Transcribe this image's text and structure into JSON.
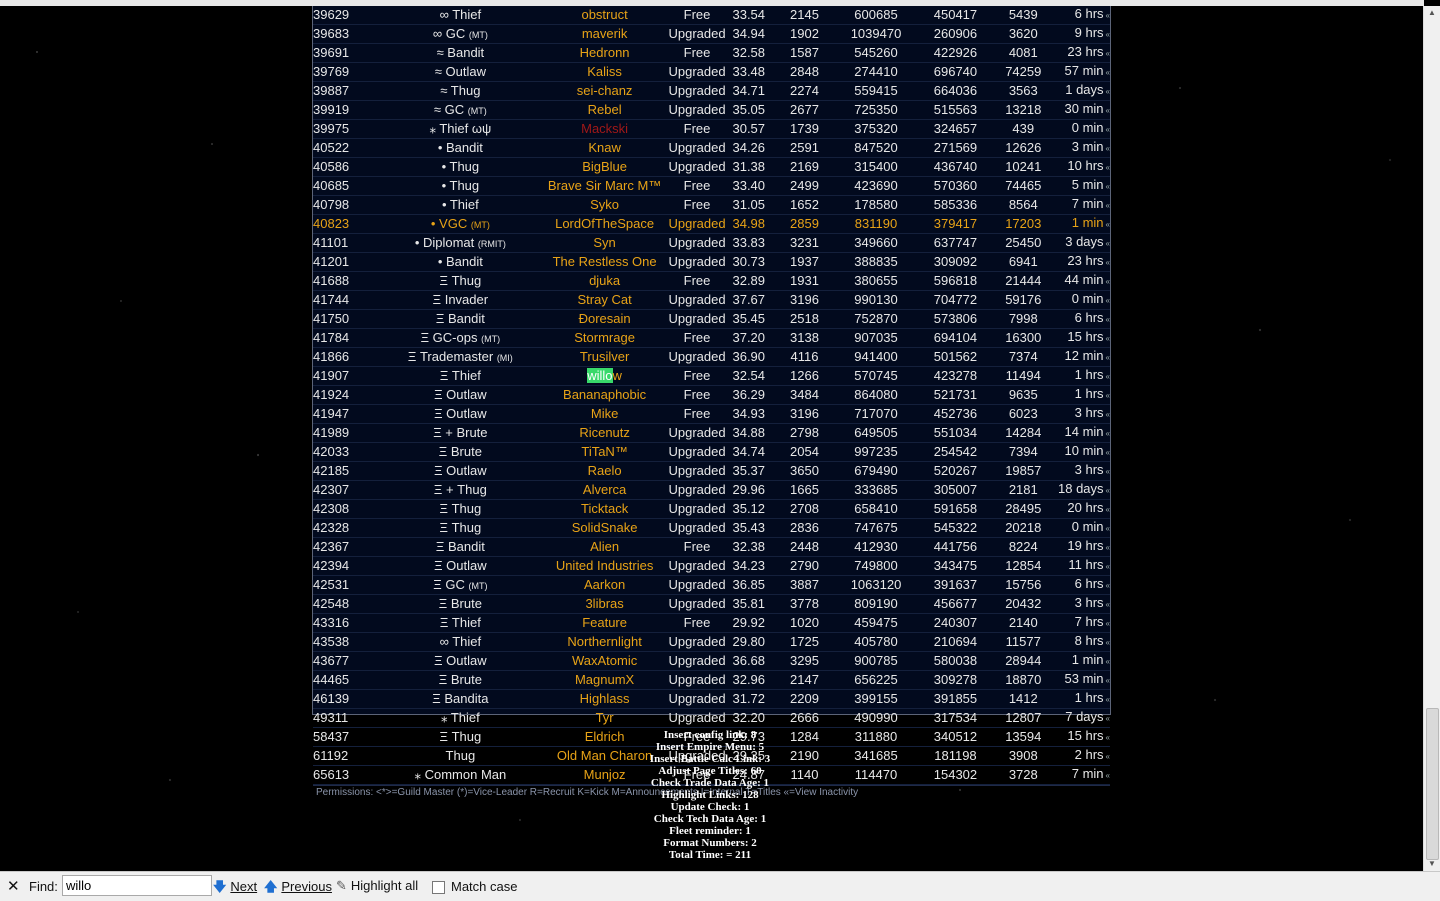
{
  "members": [
    {
      "id": "39629",
      "rank": "∞ Thief",
      "tag": "",
      "name": "obstruct",
      "acct": "Free",
      "lvl": "33.54",
      "a": "2145",
      "b": "600685",
      "c": "450417",
      "d": "5439",
      "active": "6 hrs"
    },
    {
      "id": "39683",
      "rank": "∞ GC",
      "tag": "(MT)",
      "name": "maverik",
      "acct": "Upgraded",
      "lvl": "34.94",
      "a": "1902",
      "b": "1039470",
      "c": "260906",
      "d": "3620",
      "active": "9 hrs"
    },
    {
      "id": "39691",
      "rank": "≈ Bandit",
      "tag": "",
      "name": "Hedronn",
      "acct": "Free",
      "lvl": "32.58",
      "a": "1587",
      "b": "545260",
      "c": "422926",
      "d": "4081",
      "active": "23 hrs"
    },
    {
      "id": "39769",
      "rank": "≈ Outlaw",
      "tag": "",
      "name": "Kaliss",
      "acct": "Upgraded",
      "lvl": "33.48",
      "a": "2848",
      "b": "274410",
      "c": "696740",
      "d": "74259",
      "active": "57 min"
    },
    {
      "id": "39887",
      "rank": "≈ Thug",
      "tag": "",
      "name": "sei-chanz",
      "acct": "Upgraded",
      "lvl": "34.71",
      "a": "2274",
      "b": "559415",
      "c": "664036",
      "d": "3563",
      "active": "1 days"
    },
    {
      "id": "39919",
      "rank": "≈ GC",
      "tag": "(MT)",
      "name": "Rebel",
      "acct": "Upgraded",
      "lvl": "35.05",
      "a": "2677",
      "b": "725350",
      "c": "515563",
      "d": "13218",
      "active": "30 min"
    },
    {
      "id": "39975",
      "rank": "⁎ Thief ωψ",
      "tag": "",
      "name": "Mackski",
      "acct": "Free",
      "lvl": "30.57",
      "a": "1739",
      "b": "375320",
      "c": "324657",
      "d": "439",
      "active": "0 min"
    },
    {
      "id": "40522",
      "rank": "• Bandit",
      "tag": "",
      "name": "Knaw",
      "acct": "Upgraded",
      "lvl": "34.26",
      "a": "2591",
      "b": "847520",
      "c": "271569",
      "d": "12626",
      "active": "3 min"
    },
    {
      "id": "40586",
      "rank": "• Thug",
      "tag": "",
      "name": "BigBlue",
      "acct": "Upgraded",
      "lvl": "31.38",
      "a": "2169",
      "b": "315400",
      "c": "436740",
      "d": "10241",
      "active": "10 hrs"
    },
    {
      "id": "40685",
      "rank": "• Thug",
      "tag": "",
      "name": "Brave Sir Marc M™",
      "acct": "Free",
      "lvl": "33.40",
      "a": "2499",
      "b": "423690",
      "c": "570360",
      "d": "74465",
      "active": "5 min"
    },
    {
      "id": "40798",
      "rank": "• Thief",
      "tag": "",
      "name": "Syko",
      "acct": "Free",
      "lvl": "31.05",
      "a": "1652",
      "b": "178580",
      "c": "585336",
      "d": "8564",
      "active": "7 min"
    },
    {
      "id": "40823",
      "rank": "• VGC",
      "tag": "(MT)",
      "name": "LordOfTheSpace",
      "acct": "Upgraded",
      "lvl": "34.98",
      "a": "2859",
      "b": "831190",
      "c": "379417",
      "d": "17203",
      "active": "1 min"
    },
    {
      "id": "41101",
      "rank": "• Diplomat",
      "tag": "(RMIT)",
      "name": "Syn",
      "acct": "Upgraded",
      "lvl": "33.83",
      "a": "3231",
      "b": "349660",
      "c": "637747",
      "d": "25450",
      "active": "3 days"
    },
    {
      "id": "41201",
      "rank": "• Bandit",
      "tag": "",
      "name": "The Restless One",
      "acct": "Upgraded",
      "lvl": "30.73",
      "a": "1937",
      "b": "388835",
      "c": "309092",
      "d": "6941",
      "active": "23 hrs"
    },
    {
      "id": "41688",
      "rank": "Ξ Thug",
      "tag": "",
      "name": "djuka",
      "acct": "Free",
      "lvl": "32.89",
      "a": "1931",
      "b": "380655",
      "c": "596818",
      "d": "21444",
      "active": "44 min"
    },
    {
      "id": "41744",
      "rank": "Ξ Invader",
      "tag": "",
      "name": "Stray Cat",
      "acct": "Upgraded",
      "lvl": "37.67",
      "a": "3196",
      "b": "990130",
      "c": "704772",
      "d": "59176",
      "active": "0 min"
    },
    {
      "id": "41750",
      "rank": "Ξ Bandit",
      "tag": "",
      "name": "Ðoresain",
      "acct": "Upgraded",
      "lvl": "35.45",
      "a": "2518",
      "b": "752870",
      "c": "573806",
      "d": "7998",
      "active": "6 hrs"
    },
    {
      "id": "41784",
      "rank": "Ξ GC-ops",
      "tag": "(MT)",
      "name": "Stormrage",
      "acct": "Free",
      "lvl": "37.20",
      "a": "3138",
      "b": "907035",
      "c": "694104",
      "d": "16300",
      "active": "15 hrs"
    },
    {
      "id": "41866",
      "rank": "Ξ Trademaster",
      "tag": "(MI)",
      "name": "Trusilver",
      "acct": "Upgraded",
      "lvl": "36.90",
      "a": "4116",
      "b": "941400",
      "c": "501562",
      "d": "7374",
      "active": "12 min"
    },
    {
      "id": "41907",
      "rank": "Ξ Thief",
      "tag": "",
      "name": "willow",
      "acct": "Free",
      "lvl": "32.54",
      "a": "1266",
      "b": "570745",
      "c": "423278",
      "d": "11494",
      "active": "1 hrs"
    },
    {
      "id": "41924",
      "rank": "Ξ Outlaw",
      "tag": "",
      "name": "Bananaphobic",
      "acct": "Free",
      "lvl": "36.29",
      "a": "3484",
      "b": "864080",
      "c": "521731",
      "d": "9635",
      "active": "1 hrs"
    },
    {
      "id": "41947",
      "rank": "Ξ Outlaw",
      "tag": "",
      "name": "Mike",
      "acct": "Free",
      "lvl": "34.93",
      "a": "3196",
      "b": "717070",
      "c": "452736",
      "d": "6023",
      "active": "3 hrs"
    },
    {
      "id": "41989",
      "rank": "Ξ + Brute",
      "tag": "",
      "name": "Ricenutz",
      "acct": "Upgraded",
      "lvl": "34.88",
      "a": "2798",
      "b": "649505",
      "c": "551034",
      "d": "14284",
      "active": "14 min"
    },
    {
      "id": "42033",
      "rank": "Ξ Brute",
      "tag": "",
      "name": "TiTaN™",
      "acct": "Upgraded",
      "lvl": "34.74",
      "a": "2054",
      "b": "997235",
      "c": "254542",
      "d": "7394",
      "active": "10 min"
    },
    {
      "id": "42185",
      "rank": "Ξ Outlaw",
      "tag": "",
      "name": "Raelo",
      "acct": "Upgraded",
      "lvl": "35.37",
      "a": "3650",
      "b": "679490",
      "c": "520267",
      "d": "19857",
      "active": "3 hrs"
    },
    {
      "id": "42307",
      "rank": "Ξ + Thug",
      "tag": "",
      "name": "Alverca",
      "acct": "Upgraded",
      "lvl": "29.96",
      "a": "1665",
      "b": "333685",
      "c": "305007",
      "d": "2181",
      "active": "18 days"
    },
    {
      "id": "42308",
      "rank": "Ξ Thug",
      "tag": "",
      "name": "Ticktack",
      "acct": "Upgraded",
      "lvl": "35.12",
      "a": "2708",
      "b": "658410",
      "c": "591658",
      "d": "28495",
      "active": "20 hrs"
    },
    {
      "id": "42328",
      "rank": "Ξ Thug",
      "tag": "",
      "name": "SolidSnake",
      "acct": "Upgraded",
      "lvl": "35.43",
      "a": "2836",
      "b": "747675",
      "c": "545322",
      "d": "20218",
      "active": "0 min"
    },
    {
      "id": "42367",
      "rank": "Ξ Bandit",
      "tag": "",
      "name": "Alien",
      "acct": "Free",
      "lvl": "32.38",
      "a": "2448",
      "b": "412930",
      "c": "441756",
      "d": "8224",
      "active": "19 hrs"
    },
    {
      "id": "42394",
      "rank": "Ξ Outlaw",
      "tag": "",
      "name": "United Industries",
      "acct": "Upgraded",
      "lvl": "34.23",
      "a": "2790",
      "b": "749800",
      "c": "343475",
      "d": "12854",
      "active": "11 hrs"
    },
    {
      "id": "42531",
      "rank": "Ξ GC",
      "tag": "(MT)",
      "name": "Aarkon",
      "acct": "Upgraded",
      "lvl": "36.85",
      "a": "3887",
      "b": "1063120",
      "c": "391637",
      "d": "15756",
      "active": "6 hrs"
    },
    {
      "id": "42548",
      "rank": "Ξ Brute",
      "tag": "",
      "name": "3libras",
      "acct": "Upgraded",
      "lvl": "35.81",
      "a": "3778",
      "b": "809190",
      "c": "456677",
      "d": "20432",
      "active": "3 hrs"
    },
    {
      "id": "43316",
      "rank": "Ξ Thief",
      "tag": "",
      "name": "Feature",
      "acct": "Free",
      "lvl": "29.92",
      "a": "1020",
      "b": "459475",
      "c": "240307",
      "d": "2140",
      "active": "7 hrs"
    },
    {
      "id": "43538",
      "rank": "∞ Thief",
      "tag": "",
      "name": "Northernlight",
      "acct": "Upgraded",
      "lvl": "29.80",
      "a": "1725",
      "b": "405780",
      "c": "210694",
      "d": "11577",
      "active": "8 hrs"
    },
    {
      "id": "43677",
      "rank": "Ξ Outlaw",
      "tag": "",
      "name": "WaxAtomic",
      "acct": "Upgraded",
      "lvl": "36.68",
      "a": "3295",
      "b": "900785",
      "c": "580038",
      "d": "28944",
      "active": "1 min"
    },
    {
      "id": "44465",
      "rank": "Ξ Brute",
      "tag": "",
      "name": "MagnumX",
      "acct": "Upgraded",
      "lvl": "32.96",
      "a": "2147",
      "b": "656225",
      "c": "309278",
      "d": "18870",
      "active": "53 min"
    },
    {
      "id": "46139",
      "rank": "Ξ Bandita",
      "tag": "",
      "name": "Highlass",
      "acct": "Upgraded",
      "lvl": "31.72",
      "a": "2209",
      "b": "399155",
      "c": "391855",
      "d": "1412",
      "active": "1 hrs"
    },
    {
      "id": "49311",
      "rank": "⁎ Thief",
      "tag": "",
      "name": "Tyr",
      "acct": "Upgraded",
      "lvl": "32.20",
      "a": "2666",
      "b": "490990",
      "c": "317534",
      "d": "12807",
      "active": "7 days"
    },
    {
      "id": "58437",
      "rank": "Ξ Thug",
      "tag": "",
      "name": "Eldrich",
      "acct": "Free",
      "lvl": "29.73",
      "a": "1284",
      "b": "311880",
      "c": "340512",
      "d": "13594",
      "active": "15 hrs"
    },
    {
      "id": "61192",
      "rank": "Thug",
      "tag": "",
      "name": "Old Man Charon",
      "acct": "Upgraded",
      "lvl": "29.35",
      "a": "2190",
      "b": "341685",
      "c": "181198",
      "d": "3908",
      "active": "2 hrs"
    },
    {
      "id": "65613",
      "rank": "⁎ Common Man",
      "tag": "",
      "name": "Munjoz",
      "acct": "Free",
      "lvl": "24.87",
      "a": "1140",
      "b": "114470",
      "c": "154302",
      "d": "3728",
      "active": "7 min"
    }
  ],
  "permissions_legend": "Permissions:  <*>=Guild Master  (*)=Vice-Leader  R=Recruit K=Kick M=Announcements I=Internal T=Titles «=View Inactivity",
  "inactivity_marker": "«",
  "stats": [
    "Insert config link: 8",
    "Insert Empire Menu: 5",
    "Insert Battle Calc Link: 3",
    "Adjust Page Titles: 60",
    "Check Trade Data Age: 1",
    "Highlight Links: 128",
    "Update Check: 1",
    "Check Tech Data Age: 1",
    "Fleet reminder: 1",
    "Format Numbers: 2",
    "Total Time: = 211"
  ],
  "findbar": {
    "close": "✕",
    "label": "Find:",
    "value": "willo",
    "next": "Next",
    "previous": "Previous",
    "highlight_all": "Highlight all",
    "match_case": "Match case"
  },
  "colors": {
    "highlighted_row": "#e8a317",
    "name_link": "#e8a317",
    "inactive_name": "#a01818",
    "find_match": "#38d96a"
  }
}
